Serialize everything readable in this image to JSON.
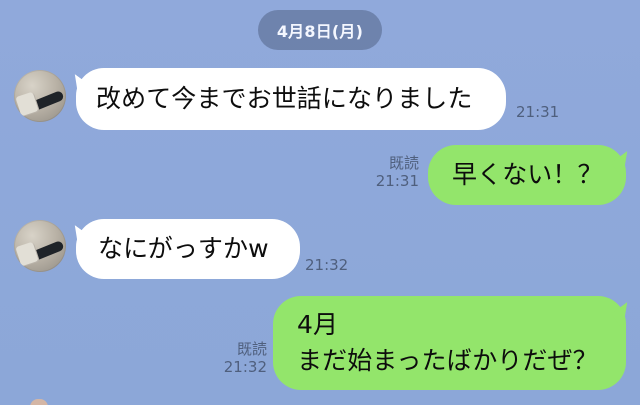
{
  "chat": {
    "date_label": "4月8日(月)",
    "messages": [
      {
        "text": "改めて今までお世話になりました",
        "time": "21:31"
      },
      {
        "read_label": "既読",
        "time": "21:31",
        "text": "早くない！？"
      },
      {
        "text": "なにがっすかw",
        "time": "21:32"
      },
      {
        "read_label": "既読",
        "time": "21:32",
        "line1": "4月",
        "line2": "まだ始まったばかりだぜ？"
      }
    ]
  },
  "colors": {
    "background": "#8fa9d9",
    "incoming_bubble": "#ffffff",
    "outgoing_bubble": "#93e56b",
    "date_pill": "#56688c",
    "meta_text": "#4f5f7d",
    "message_text": "#0d0d0d"
  },
  "icons": {
    "avatar": "avatar-photo"
  }
}
